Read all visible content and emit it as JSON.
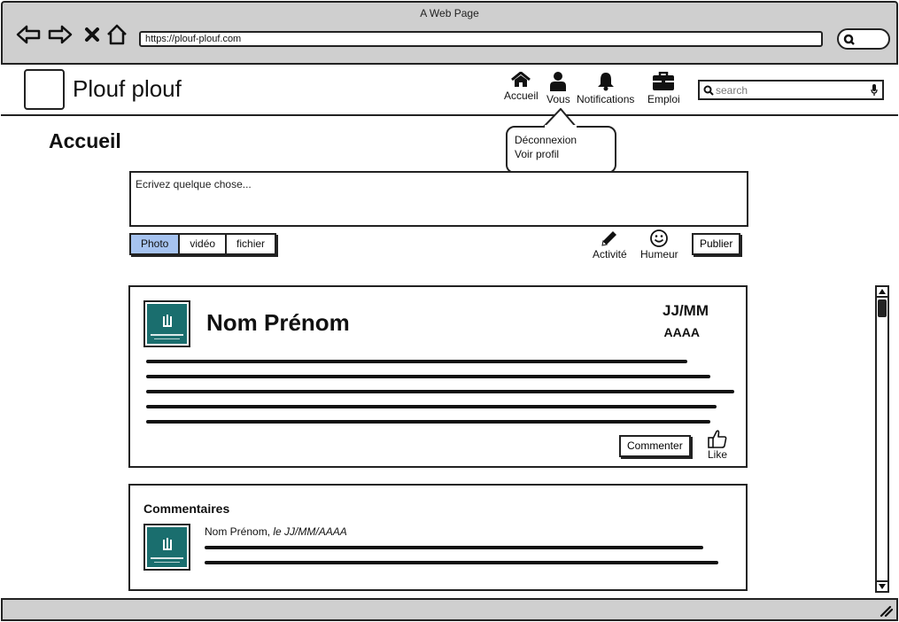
{
  "browser": {
    "window_title": "A Web Page",
    "url": "https://plouf-plouf.com",
    "icons": [
      "back-arrow-icon",
      "forward-arrow-icon",
      "close-icon",
      "home-icon",
      "search-icon"
    ]
  },
  "header": {
    "site_name": "Plouf plouf",
    "nav": [
      {
        "label": "Accueil",
        "icon": "home-icon"
      },
      {
        "label": "Vous",
        "icon": "user-icon"
      },
      {
        "label": "Notifications",
        "icon": "bell-icon"
      },
      {
        "label": "Emploi",
        "icon": "briefcase-icon"
      }
    ],
    "search_placeholder": "search"
  },
  "dropdown": {
    "items": [
      "Déconnexion",
      "Voir profil"
    ]
  },
  "main": {
    "heading": "Accueil",
    "composer_placeholder": "Ecrivez quelque chose...",
    "media_tabs": [
      {
        "label": "Photo",
        "active": true
      },
      {
        "label": "vidéo",
        "active": false
      },
      {
        "label": "fichier",
        "active": false
      }
    ],
    "tools": [
      {
        "label": "Activité",
        "icon": "pencil-icon"
      },
      {
        "label": "Humeur",
        "icon": "smiley-icon"
      }
    ],
    "publish_label": "Publier"
  },
  "post": {
    "author": "Nom Prénom",
    "date_day": "JJ/MM",
    "date_year": "AAAA",
    "comment_label": "Commenter",
    "like_label": "Like"
  },
  "comments": {
    "title": "Commentaires",
    "items": [
      {
        "author": "Nom Prénom,",
        "date": "le JJ/MM/AAAA"
      }
    ]
  },
  "colors": {
    "active_tab": "#a6c3f0",
    "avatar_bg": "#1a6e6e",
    "chrome_bg": "#cfcfcf"
  }
}
